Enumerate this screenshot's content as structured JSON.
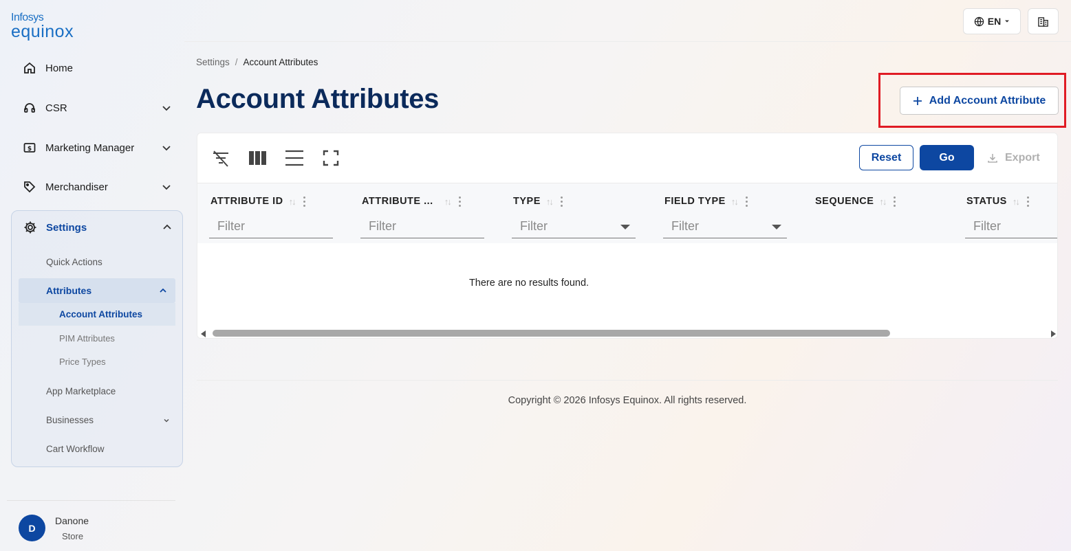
{
  "brand": {
    "line1": "Infosys",
    "line2": "equinox",
    "color": "#1a6fc4"
  },
  "sidebar": {
    "items": [
      {
        "label": "Home",
        "icon": "home-icon"
      },
      {
        "label": "CSR",
        "icon": "headset-icon"
      },
      {
        "label": "Marketing Manager",
        "icon": "dollar-icon"
      },
      {
        "label": "Merchandiser",
        "icon": "tag-icon"
      },
      {
        "label": "Settings",
        "icon": "gear-icon"
      }
    ],
    "settings_sub": {
      "quick_actions": "Quick Actions",
      "attributes": "Attributes",
      "account_attributes": "Account Attributes",
      "pim_attributes": "PIM Attributes",
      "price_types": "Price Types",
      "app_marketplace": "App Marketplace",
      "businesses": "Businesses",
      "cart_workflow": "Cart Workflow"
    },
    "user": {
      "initial": "D",
      "name": "Danone",
      "role": "Store"
    }
  },
  "topbar": {
    "language": "EN"
  },
  "breadcrumb": {
    "parent": "Settings",
    "separator": "/",
    "current": "Account Attributes"
  },
  "page": {
    "title": "Account Attributes",
    "add_button": "Add Account Attribute"
  },
  "toolbar": {
    "reset": "Reset",
    "go": "Go",
    "export": "Export"
  },
  "table": {
    "columns": [
      {
        "label": "ATTRIBUTE ID",
        "filter": "Filter",
        "dropdown": false
      },
      {
        "label": "ATTRIBUTE ...",
        "filter": "Filter",
        "dropdown": false
      },
      {
        "label": "TYPE",
        "filter": "Filter",
        "dropdown": true
      },
      {
        "label": "FIELD TYPE",
        "filter": "Filter",
        "dropdown": true
      },
      {
        "label": "SEQUENCE",
        "filter": "",
        "dropdown": false
      },
      {
        "label": "STATUS",
        "filter": "Filter",
        "dropdown": false
      }
    ],
    "empty_message": "There are no results found."
  },
  "footer": {
    "copyright": "Copyright © 2026 Infosys Equinox. All rights reserved."
  },
  "colors": {
    "primary": "#0d47a1",
    "title": "#0b2a5b",
    "highlight": "#e01b24"
  }
}
